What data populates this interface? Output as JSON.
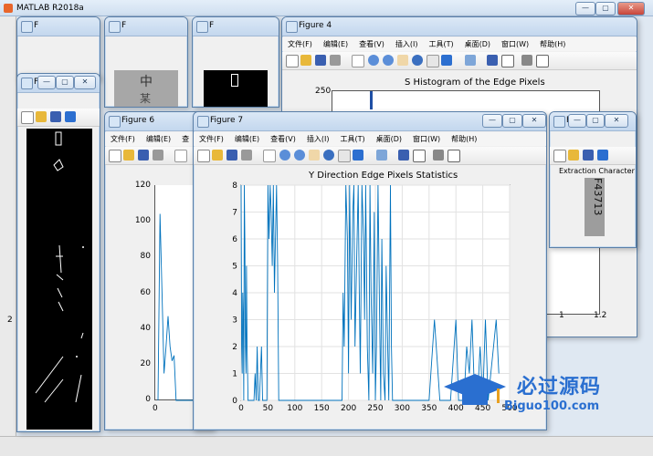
{
  "app": {
    "title": "MATLAB R2018a"
  },
  "truncated_title": "F",
  "menus": {
    "file": "文件(F)",
    "edit": "编辑(E)",
    "view": "查看(V)",
    "insert": "插入(I)",
    "tools": "工具(T)",
    "desktop": "桌面(D)",
    "window": "窗口(W)",
    "help": "帮助(H)",
    "view_trunc": "查"
  },
  "window_buttons": {
    "min": "—",
    "max": "▢",
    "close": "✕"
  },
  "figure4": {
    "title": "Figure 4",
    "chart_title": "S Histogram of the Edge Pixels",
    "ytick_top": "250",
    "xticks": [
      "1",
      "1.2"
    ]
  },
  "figure6": {
    "title": "Figure 6",
    "yticks": [
      "120",
      "100",
      "80",
      "60",
      "40",
      "20",
      "0"
    ],
    "xtick": "0"
  },
  "figure7": {
    "title": "Figure 7",
    "xticks": [
      "0",
      "50",
      "100",
      "150",
      "200",
      "250",
      "300",
      "350",
      "400",
      "450",
      "500"
    ],
    "yticks": [
      "8",
      "7",
      "6",
      "5",
      "4",
      "3",
      "2",
      "1",
      "0"
    ]
  },
  "extract": {
    "title": "F",
    "label": "Extraction Character",
    "plate_text": "F43713"
  },
  "small_figs": {
    "chars": [
      "中",
      "某"
    ]
  },
  "watermark": {
    "brand": "必过源码",
    "url": "Biguo100.com"
  },
  "left_edge_number": "2",
  "chart_data": [
    {
      "type": "line",
      "title": "Y Direction Edge Pixels Statistics",
      "xlim": [
        0,
        500
      ],
      "ylim": [
        0,
        8
      ],
      "grid": true,
      "x": [
        0,
        1,
        2,
        3,
        4,
        5,
        6,
        7,
        8,
        9,
        10,
        11,
        12,
        13,
        14,
        15,
        18,
        20,
        22,
        24,
        26,
        28,
        30,
        32,
        34,
        36,
        38,
        40,
        42,
        44,
        46,
        48,
        50,
        52,
        54,
        56,
        58,
        60,
        62,
        64,
        66,
        68,
        70,
        75,
        80,
        85,
        90,
        95,
        100,
        105,
        110,
        115,
        120,
        125,
        130,
        135,
        140,
        145,
        150,
        155,
        160,
        165,
        170,
        175,
        180,
        182,
        185,
        188,
        190,
        192,
        195,
        198,
        200,
        202,
        205,
        208,
        210,
        212,
        215,
        218,
        220,
        222,
        225,
        228,
        230,
        232,
        235,
        238,
        240,
        242,
        245,
        248,
        250,
        252,
        255,
        258,
        260,
        262,
        265,
        268,
        270,
        272,
        275,
        278,
        280,
        282,
        285,
        290,
        300,
        310,
        320,
        330,
        335,
        340,
        345,
        350,
        360,
        370,
        380,
        390,
        400,
        405,
        410,
        415,
        420,
        425,
        430,
        435,
        440,
        445,
        450,
        455,
        460,
        465,
        470,
        475,
        480
      ],
      "y": [
        8,
        2,
        1,
        4,
        3,
        0,
        8,
        6,
        2,
        1,
        5,
        2,
        1,
        0,
        0,
        0,
        0,
        0,
        0,
        0,
        1,
        0,
        2,
        0,
        0,
        1,
        2,
        0,
        0,
        0,
        0,
        0,
        8,
        6,
        8,
        7,
        5,
        8,
        4,
        6,
        8,
        5,
        0,
        0,
        0,
        0,
        0,
        0,
        0,
        0,
        0,
        0,
        0,
        0,
        0,
        0,
        0,
        0,
        0,
        0,
        0,
        0,
        0,
        0,
        0,
        0,
        0,
        0,
        4,
        2,
        8,
        6,
        1,
        8,
        3,
        7,
        8,
        2,
        5,
        8,
        4,
        1,
        8,
        6,
        3,
        8,
        2,
        0,
        8,
        4,
        1,
        7,
        0,
        2,
        8,
        3,
        0,
        6,
        1,
        0,
        5,
        3,
        0,
        8,
        2,
        0,
        0,
        0,
        0,
        0,
        0,
        0,
        0,
        0,
        0,
        0,
        3,
        0,
        0,
        0,
        3,
        0,
        0,
        0,
        2,
        1,
        3,
        0,
        0,
        2,
        0,
        3,
        0,
        1,
        2,
        3,
        1,
        2,
        0,
        0
      ]
    },
    {
      "type": "line",
      "title": "",
      "ylim": [
        0,
        120
      ],
      "x": [
        0,
        1,
        2,
        3,
        4,
        5,
        6,
        7,
        8,
        9,
        10
      ],
      "y": [
        0,
        104,
        60,
        15,
        30,
        47,
        30,
        22,
        25,
        0,
        0
      ]
    }
  ]
}
